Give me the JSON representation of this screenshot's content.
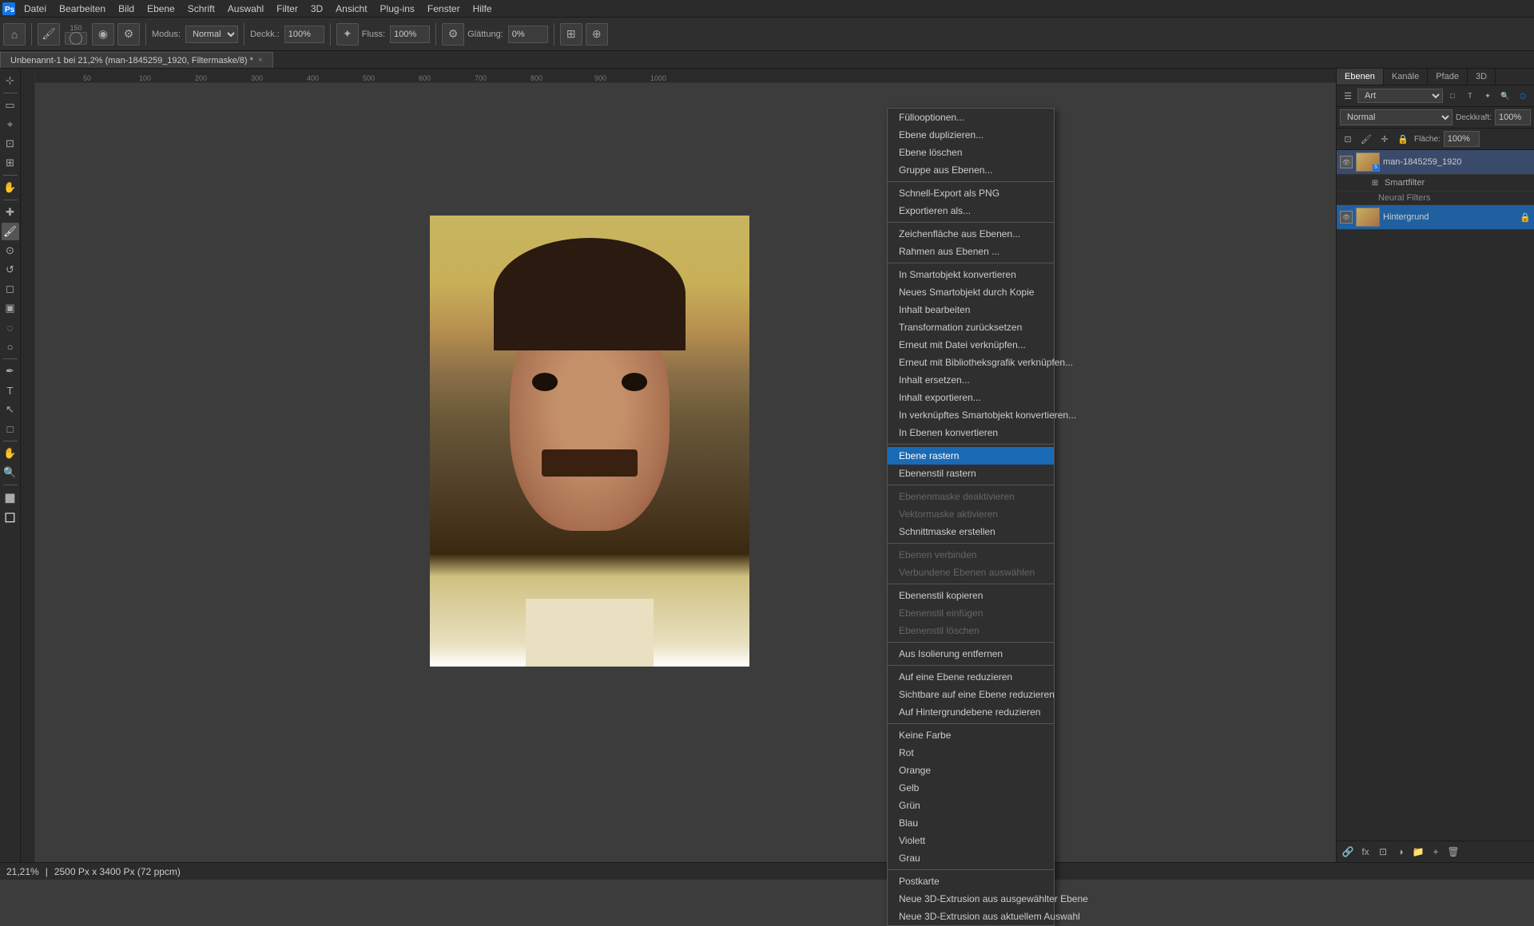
{
  "app": {
    "title": "Adobe Photoshop"
  },
  "menubar": {
    "items": [
      "Datei",
      "Bearbeiten",
      "Bild",
      "Ebene",
      "Schrift",
      "Auswahl",
      "Filter",
      "3D",
      "Ansicht",
      "Plug-ins",
      "Fenster",
      "Hilfe"
    ]
  },
  "toolbar": {
    "mode_label": "Modus:",
    "mode_value": "Normal",
    "deck_label": "Deckk.:",
    "deck_value": "100%",
    "flow_label": "Fluss:",
    "flow_value": "100%",
    "smoothing_label": "Glättung:",
    "smoothing_value": "0%",
    "brush_size": "150"
  },
  "tab": {
    "title": "Unbenannt-1 bei 21,2% (man-1845259_1920, Filtermaske/8) *",
    "close": "×"
  },
  "layers_panel": {
    "tabs": [
      "Ebenen",
      "Kanäle",
      "Pfade",
      "3D"
    ],
    "search_placeholder": "Art",
    "blend_mode": "Normal",
    "opacity_label": "Deckkraft:",
    "opacity_value": "100%",
    "fill_label": "Fläche:",
    "fill_value": "100%",
    "layers": [
      {
        "name": "Hintergrund",
        "lock": true,
        "type": "background"
      }
    ],
    "smartfilter_label": "Smartfilter",
    "neural_filters_label": "Neural Filters"
  },
  "context_menu": {
    "items": [
      {
        "label": "Füllooptionen...",
        "enabled": true,
        "highlighted": false
      },
      {
        "label": "Ebene duplizieren...",
        "enabled": true,
        "highlighted": false
      },
      {
        "label": "Ebene löschen",
        "enabled": true,
        "highlighted": false
      },
      {
        "label": "Gruppe aus Ebenen...",
        "enabled": true,
        "highlighted": false
      },
      {
        "separator": true
      },
      {
        "label": "Schnell-Export als PNG",
        "enabled": true,
        "highlighted": false
      },
      {
        "label": "Exportieren als...",
        "enabled": true,
        "highlighted": false
      },
      {
        "separator": true
      },
      {
        "label": "Zeichenfläche aus Ebenen...",
        "enabled": true,
        "highlighted": false
      },
      {
        "label": "Rahmen aus Ebenen ...",
        "enabled": true,
        "highlighted": false
      },
      {
        "separator": true
      },
      {
        "label": "In Smartobjekt konvertieren",
        "enabled": true,
        "highlighted": false
      },
      {
        "label": "Neues Smartobjekt durch Kopie",
        "enabled": true,
        "highlighted": false
      },
      {
        "label": "Inhalt bearbeiten",
        "enabled": true,
        "highlighted": false
      },
      {
        "label": "Transformation zurücksetzen",
        "enabled": true,
        "highlighted": false
      },
      {
        "label": "Erneut mit Datei verknüpfen...",
        "enabled": true,
        "highlighted": false
      },
      {
        "label": "Erneut mit Bibliotheksgrafik verknüpfen...",
        "enabled": true,
        "highlighted": false
      },
      {
        "label": "Inhalt ersetzen...",
        "enabled": true,
        "highlighted": false
      },
      {
        "label": "Inhalt exportieren...",
        "enabled": true,
        "highlighted": false
      },
      {
        "label": "In verknüpftes Smartobjekt konvertieren...",
        "enabled": true,
        "highlighted": false
      },
      {
        "label": "In Ebenen konvertieren",
        "enabled": true,
        "highlighted": false
      },
      {
        "separator": true
      },
      {
        "label": "Ebene rastern",
        "enabled": true,
        "highlighted": true
      },
      {
        "label": "Ebenenstil rastern",
        "enabled": true,
        "highlighted": false
      },
      {
        "separator": true
      },
      {
        "label": "Ebenenmaske deaktivieren",
        "enabled": false,
        "highlighted": false
      },
      {
        "label": "Vektormaske aktivieren",
        "enabled": false,
        "highlighted": false
      },
      {
        "label": "Schnittmaske erstellen",
        "enabled": true,
        "highlighted": false
      },
      {
        "separator": true
      },
      {
        "label": "Ebenen verbinden",
        "enabled": false,
        "highlighted": false
      },
      {
        "label": "Verbundene Ebenen auswählen",
        "enabled": false,
        "highlighted": false
      },
      {
        "separator": true
      },
      {
        "label": "Ebenenstil kopieren",
        "enabled": true,
        "highlighted": false
      },
      {
        "label": "Ebenenstil einfügen",
        "enabled": false,
        "highlighted": false
      },
      {
        "label": "Ebenenstil löschen",
        "enabled": false,
        "highlighted": false
      },
      {
        "separator": true
      },
      {
        "label": "Aus Isolierung entfernen",
        "enabled": true,
        "highlighted": false
      },
      {
        "separator": true
      },
      {
        "label": "Auf eine Ebene reduzieren",
        "enabled": true,
        "highlighted": false
      },
      {
        "label": "Sichtbare auf eine Ebene reduzieren",
        "enabled": true,
        "highlighted": false
      },
      {
        "label": "Auf Hintergrundebene reduzieren",
        "enabled": true,
        "highlighted": false
      },
      {
        "separator": true
      },
      {
        "label": "Keine Farbe",
        "enabled": true,
        "highlighted": false
      },
      {
        "label": "Rot",
        "enabled": true,
        "highlighted": false
      },
      {
        "label": "Orange",
        "enabled": true,
        "highlighted": false
      },
      {
        "label": "Gelb",
        "enabled": true,
        "highlighted": false
      },
      {
        "label": "Grün",
        "enabled": true,
        "highlighted": false
      },
      {
        "label": "Blau",
        "enabled": true,
        "highlighted": false
      },
      {
        "label": "Violett",
        "enabled": true,
        "highlighted": false
      },
      {
        "label": "Grau",
        "enabled": true,
        "highlighted": false
      },
      {
        "separator": true
      },
      {
        "label": "Postkarte",
        "enabled": true,
        "highlighted": false
      },
      {
        "label": "Neue 3D-Extrusion aus ausgewählter Ebene",
        "enabled": true,
        "highlighted": false
      },
      {
        "label": "Neue 3D-Extrusion aus aktuellem Auswahl",
        "enabled": true,
        "highlighted": false
      }
    ]
  },
  "statusbar": {
    "zoom": "21,21%",
    "info": "2500 Px x 3400 Px (72 ppcm)"
  },
  "colors": {
    "highlight": "#1a6bb5",
    "menu_bg": "#2f2f2f",
    "toolbar_bg": "#2f2f2f",
    "panel_bg": "#2b2b2b"
  }
}
